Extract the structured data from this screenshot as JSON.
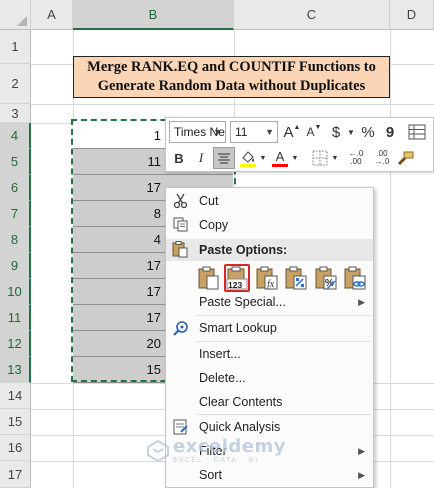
{
  "columns": [
    "A",
    "B",
    "C",
    "D"
  ],
  "rows": [
    "1",
    "2",
    "3",
    "4",
    "5",
    "6",
    "7",
    "8",
    "9",
    "10",
    "11",
    "12",
    "13",
    "14",
    "15",
    "16",
    "17"
  ],
  "title": {
    "line1": "Merge RANK.EQ and COUNTIF Functions to",
    "line2": "Generate Random Data without Duplicates"
  },
  "cells": [
    "1",
    "11",
    "17",
    "8",
    "4",
    "17",
    "17",
    "17",
    "20",
    "15"
  ],
  "mini_toolbar": {
    "font_name": "Times Ne",
    "font_size": "11",
    "grow_font": "A",
    "shrink_font": "A",
    "currency": "$",
    "percent": "%",
    "comma": "9",
    "bold": "B",
    "italic": "I",
    "font_color_label": "A",
    "increase_decimal": "←.00\n.0",
    "decrease_decimal": ".00\n→.0",
    "highlight_color": "#ffff00",
    "font_color": "#ff0000"
  },
  "context_menu": {
    "cut": "Cut",
    "copy": "Copy",
    "paste_options": "Paste Options:",
    "paste_values_label": "123",
    "paste_special": "Paste Special...",
    "smart_lookup": "Smart Lookup",
    "insert": "Insert...",
    "delete": "Delete...",
    "clear_contents": "Clear Contents",
    "quick_analysis": "Quick Analysis",
    "filter": "Filter",
    "sort": "Sort"
  },
  "watermark": {
    "name": "exceldemy",
    "tagline": "EXCEL · DATA · BI"
  },
  "colors": {
    "title_fill": "#fbd5b6",
    "selection_green": "#217346",
    "cell_shade": "#cdcdcd",
    "paste_values_highlight": "#d9252a"
  }
}
